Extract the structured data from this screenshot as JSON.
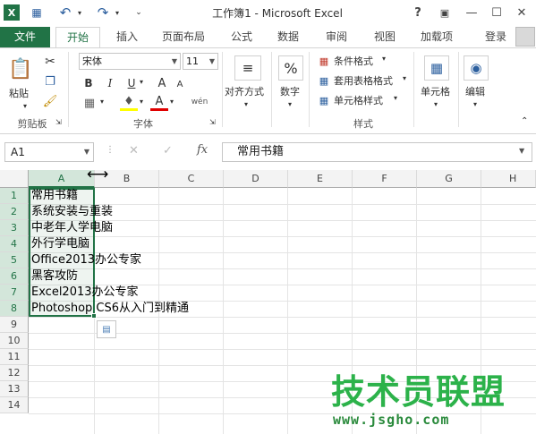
{
  "window": {
    "title": "工作簿1 - Microsoft Excel",
    "controls": {
      "help": "?",
      "ribbon_display": "▣",
      "minimize": "—",
      "restore": "☐",
      "close": "✕"
    }
  },
  "qat": {
    "save": "💾",
    "undo": "↶",
    "redo": "↷",
    "customize": "⌄"
  },
  "tabs": [
    {
      "label": "文件"
    },
    {
      "label": "开始"
    },
    {
      "label": "插入"
    },
    {
      "label": "页面布局"
    },
    {
      "label": "公式"
    },
    {
      "label": "数据"
    },
    {
      "label": "审阅"
    },
    {
      "label": "视图"
    },
    {
      "label": "加载项"
    }
  ],
  "signin": "登录",
  "ribbon": {
    "clipboard": {
      "paste": "粘贴",
      "group": "剪贴板"
    },
    "font": {
      "name": "宋体",
      "size": "11",
      "bold": "B",
      "italic": "I",
      "underline": "U",
      "grow": "A",
      "shrink": "A",
      "group": "字体",
      "phonetic": "wén"
    },
    "alignment": {
      "label": "对齐方式"
    },
    "number": {
      "label": "数字",
      "icon": "%"
    },
    "styles": {
      "conditional": "条件格式",
      "table": "套用表格格式",
      "cell_styles": "单元格样式",
      "group": "样式"
    },
    "cells": {
      "label": "单元格"
    },
    "editing": {
      "label": "编辑"
    }
  },
  "formula_bar": {
    "name_box": "A1",
    "fx": "fx",
    "cancel": "✕",
    "enter": "✓",
    "value": "常用书籍"
  },
  "columns": [
    "A",
    "B",
    "C",
    "D",
    "E",
    "F",
    "G",
    "H"
  ],
  "rows": [
    "1",
    "2",
    "3",
    "4",
    "5",
    "6",
    "7",
    "8",
    "9",
    "10",
    "11",
    "12",
    "13",
    "14"
  ],
  "cells": [
    "常用书籍",
    "系统安装与重装",
    "中老年人学电脑",
    "外行学电脑",
    "Office2013办公专家",
    "黑客攻防",
    "Excel2013办公专家",
    "Photoshop CS6从入门到精通"
  ],
  "watermark": {
    "title": "技术员联盟",
    "url": "www.jsgho.com"
  },
  "colors": {
    "accent": "#217346",
    "watermark": "#2cb24a"
  }
}
